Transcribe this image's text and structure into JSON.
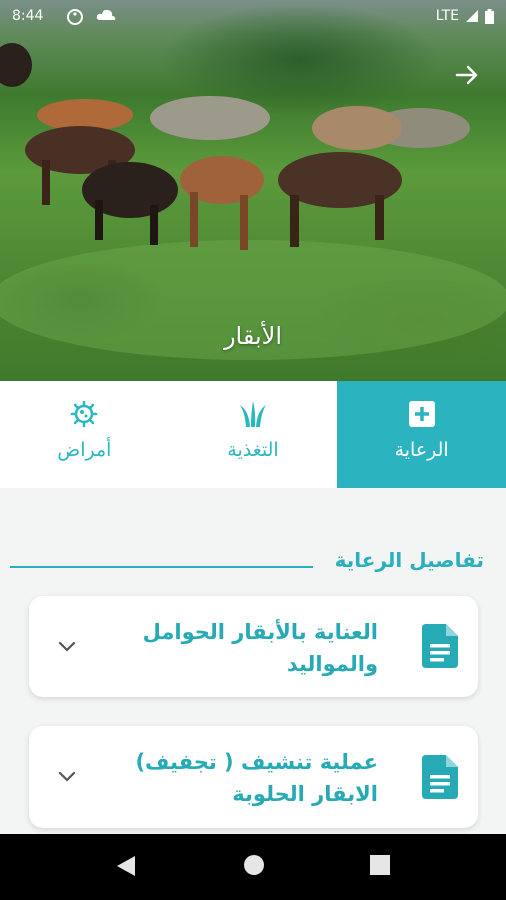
{
  "status_bar": {
    "time": "8:44",
    "network": "LTE"
  },
  "hero": {
    "title": "الأبقار"
  },
  "tabs": [
    {
      "label": "أمراض",
      "icon": "virus-icon"
    },
    {
      "label": "التغذية",
      "icon": "grass-icon"
    },
    {
      "label": "الرعاية",
      "icon": "medical-plus-icon",
      "active": true
    }
  ],
  "section": {
    "title": "تفاصيل الرعاية"
  },
  "cards": [
    {
      "text": "العناية بالأبقار الحوامل والمواليد",
      "icon": "document-icon"
    },
    {
      "text": "عملية تنشيف ( تجفيف) الابقار الحلوبة",
      "icon": "document-icon"
    }
  ],
  "colors": {
    "accent": "#2bb3bf",
    "text_accent": "#26aab6",
    "background": "#f3f4f4"
  }
}
